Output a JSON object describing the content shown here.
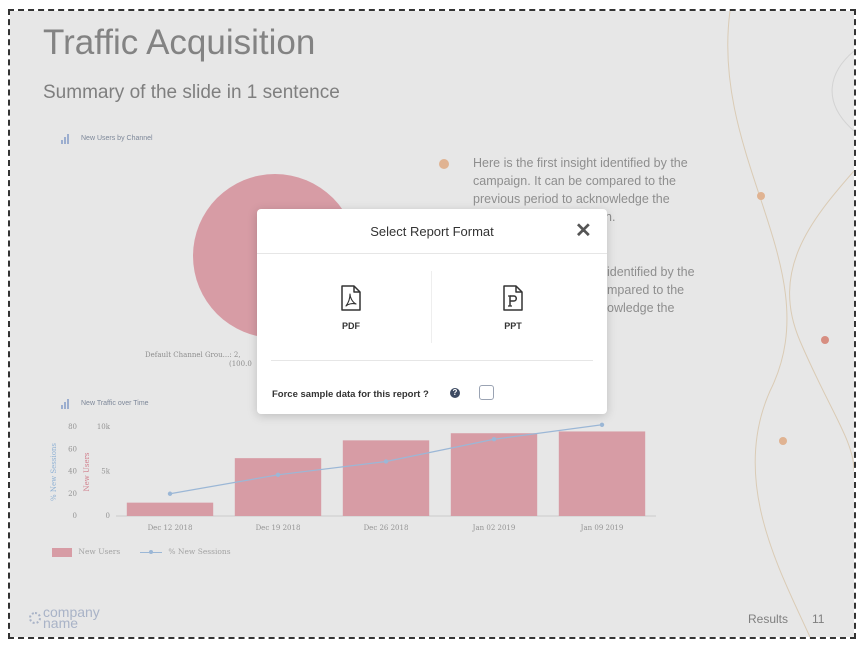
{
  "slide": {
    "title": "Traffic Acquisition",
    "subtitle": "Summary of the slide in 1 sentence",
    "pie_chart_label": "New Users by Channel",
    "pie_slice_label": "Default Channel Grou...: 2,",
    "pie_slice_percent": "(100.0",
    "time_chart_label": "New Traffic over Time",
    "insights": [
      [
        "Here is the first insight identified by the",
        "campaign. It can be compared to the",
        "previous period to acknowledge the",
        "n."
      ],
      [
        "identified by the",
        "mpared to the",
        "owledge the"
      ]
    ],
    "footer_logo_line1": "company",
    "footer_logo_line2": "name",
    "footer_section": "Results",
    "page_number": "11"
  },
  "chart_data": {
    "type": "bar",
    "categories": [
      "Dec 12 2018",
      "Dec 19 2018",
      "Dec 26 2018",
      "Jan 02 2019",
      "Jan 09 2019"
    ],
    "series": [
      {
        "name": "New Users",
        "type": "bar",
        "axis": "right",
        "values": [
          1500,
          6500,
          8500,
          9300,
          9500
        ],
        "color": "#e9a9b3"
      },
      {
        "name": "% New Sessions",
        "type": "line",
        "axis": "left",
        "values": [
          20,
          37,
          49,
          69,
          82
        ],
        "color": "#a8c6e8"
      }
    ],
    "y_left": {
      "label": "% New Sessions",
      "ticks": [
        "80",
        "60",
        "40",
        "20",
        "0"
      ],
      "ylim": [
        0,
        80
      ]
    },
    "y_right": {
      "label": "New Users",
      "ticks": [
        "10k",
        "5k",
        "0"
      ],
      "ylim": [
        0,
        10000
      ]
    },
    "pie": {
      "slices": [
        {
          "label": "Default Channel Grou...",
          "value": 100.0
        }
      ],
      "color": "#e9a9b3"
    }
  },
  "modal": {
    "title": "Select Report Format",
    "close_glyph": "✕",
    "options": [
      {
        "label": "PDF",
        "icon": "pdf-file-icon"
      },
      {
        "label": "PPT",
        "icon": "ppt-file-icon"
      }
    ],
    "force_sample_label": "Force sample data for this report ?",
    "help_glyph": "?",
    "force_sample_checked": false
  }
}
